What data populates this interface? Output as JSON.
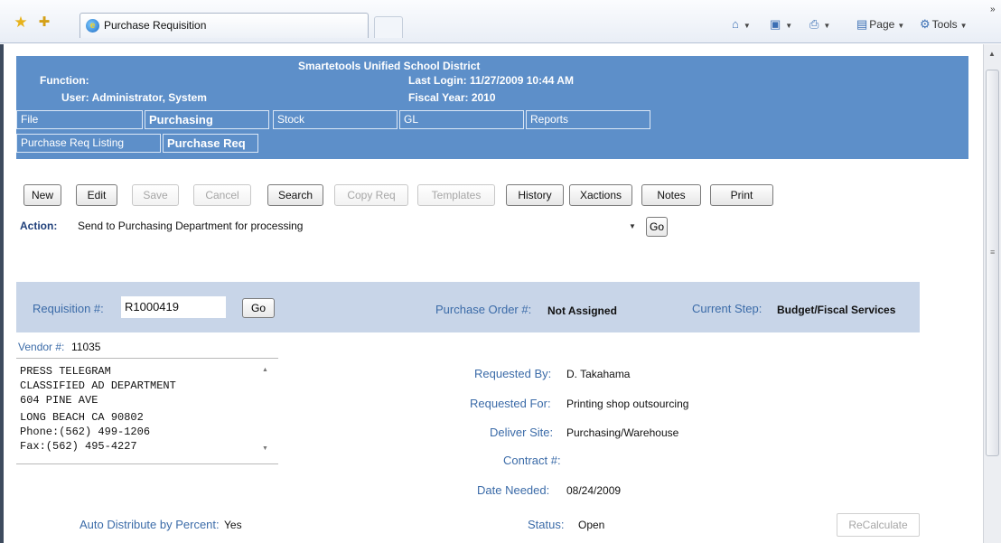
{
  "browser": {
    "tab_title": "Purchase Requisition",
    "cmd_page": "Page",
    "cmd_tools": "Tools",
    "overflow": "»"
  },
  "header": {
    "district": "Smartetools Unified School District",
    "function_label": "Function:",
    "user": "User: Administrator, System",
    "last_login": "Last Login: 11/27/2009 10:44 AM",
    "fiscal_year": "Fiscal Year: 2010"
  },
  "menu": {
    "items": [
      "File",
      "Purchasing",
      "Stock",
      "GL",
      "Reports"
    ],
    "subitems": [
      "Purchase Req Listing",
      "Purchase Req"
    ]
  },
  "toolbar": {
    "new": "New",
    "edit": "Edit",
    "save": "Save",
    "cancel": "Cancel",
    "search": "Search",
    "copy_req": "Copy Req",
    "templates": "Templates",
    "history": "History",
    "xactions": "Xactions",
    "notes": "Notes",
    "print": "Print"
  },
  "action": {
    "label": "Action:",
    "value": "Send to Purchasing Department for processing",
    "go": "Go"
  },
  "requisition": {
    "label": "Requisition #:",
    "value": "R1000419",
    "go": "Go",
    "po_label": "Purchase Order #:",
    "po_value": "Not Assigned",
    "step_label": "Current Step:",
    "step_value": "Budget/Fiscal Services"
  },
  "vendor": {
    "label": "Vendor #:",
    "number": "11035",
    "address_lines": [
      "PRESS TELEGRAM",
      "CLASSIFIED AD DEPARTMENT",
      "604 PINE AVE",
      "LONG BEACH CA 90802",
      "Phone:(562) 499-1206",
      "Fax:(562) 495-4227"
    ]
  },
  "details": {
    "requested_by_label": "Requested By:",
    "requested_by": "D. Takahama",
    "requested_for_label": "Requested For:",
    "requested_for": "Printing shop outsourcing",
    "deliver_site_label": "Deliver Site:",
    "deliver_site": "Purchasing/Warehouse",
    "contract_label": "Contract #:",
    "contract": "",
    "date_needed_label": "Date Needed:",
    "date_needed": "08/24/2009"
  },
  "footer": {
    "auto_distribute_label": "Auto Distribute by Percent:",
    "auto_distribute_value": "Yes",
    "status_label": "Status:",
    "status_value": "Open",
    "recalculate": "ReCalculate"
  }
}
